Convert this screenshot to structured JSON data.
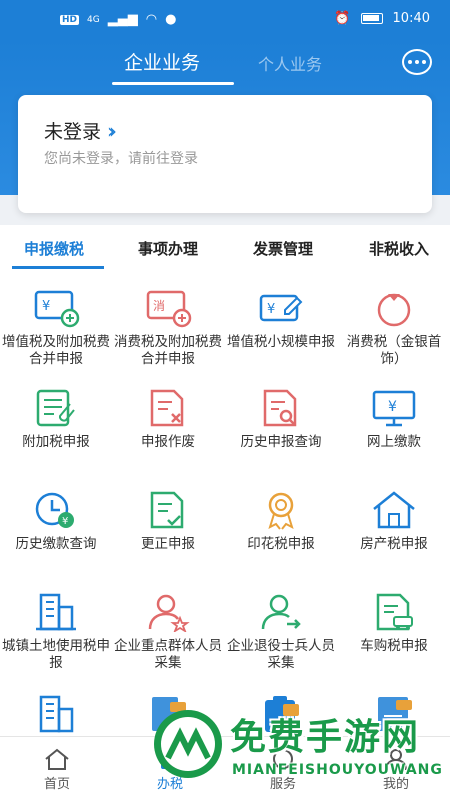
{
  "status": {
    "time": "10:40",
    "hd": "HD",
    "net": "4G"
  },
  "top_tabs": {
    "enterprise": "企业业务",
    "personal": "个人业务"
  },
  "login": {
    "title": "未登录",
    "subtitle": "您尚未登录，请前往登录"
  },
  "category_tabs": [
    "申报缴税",
    "事项办理",
    "发票管理",
    "非税收入"
  ],
  "items": [
    {
      "label": "增值税及附加税费合并申报",
      "icon": "vat-combined-icon"
    },
    {
      "label": "消费税及附加税费合并申报",
      "icon": "consumption-tax-icon"
    },
    {
      "label": "增值税小规模申报",
      "icon": "vat-small-scale-icon"
    },
    {
      "label": "消费税（金银首饰）",
      "icon": "jewelry-icon"
    },
    {
      "label": "附加税申报",
      "icon": "surcharge-icon"
    },
    {
      "label": "申报作废",
      "icon": "void-declaration-icon"
    },
    {
      "label": "历史申报查询",
      "icon": "history-query-icon"
    },
    {
      "label": "网上缴款",
      "icon": "online-payment-icon"
    },
    {
      "label": "历史缴款查询",
      "icon": "history-payment-icon"
    },
    {
      "label": "更正申报",
      "icon": "correction-icon"
    },
    {
      "label": "印花税申报",
      "icon": "stamp-tax-icon"
    },
    {
      "label": "房产税申报",
      "icon": "property-tax-icon"
    },
    {
      "label": "城镇土地使用税申报",
      "icon": "land-use-tax-icon"
    },
    {
      "label": "企业重点群体人员采集",
      "icon": "key-group-icon"
    },
    {
      "label": "企业退役士兵人员采集",
      "icon": "veteran-icon"
    },
    {
      "label": "车购税申报",
      "icon": "vehicle-tax-icon"
    }
  ],
  "bottom_nav": {
    "home": "首页",
    "office": "办税",
    "service": "服务",
    "mine": "我的"
  },
  "watermark": {
    "title": "免费手游网",
    "sub": "MIANFEISHOUYOUWANG"
  },
  "colors": {
    "primary": "#1d7fd6",
    "red": "#e06a6a",
    "green": "#2dab6f",
    "orange": "#e8a13a"
  }
}
